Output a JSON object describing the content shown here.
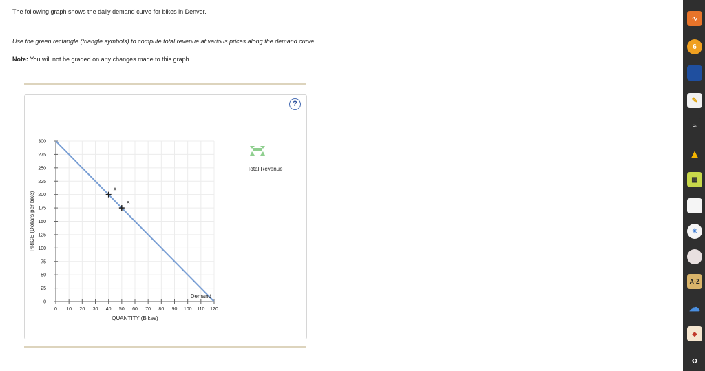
{
  "instructions": {
    "line1": "The following graph shows the daily demand curve for bikes in Denver.",
    "line2": "Use the green rectangle (triangle symbols) to compute total revenue at various prices along the demand curve.",
    "note_label": "Note:",
    "note_text": " You will not be graded on any changes made to this graph."
  },
  "help_button": {
    "label": "?"
  },
  "palette": {
    "label": "Total Revenue",
    "color": "#8fcf8f"
  },
  "chart_data": {
    "type": "line",
    "xlabel": "QUANTITY (Bikes)",
    "ylabel": "PRICE (Dollars per bike)",
    "xlim": [
      0,
      120
    ],
    "ylim": [
      0,
      300
    ],
    "x_ticks": [
      0,
      10,
      20,
      30,
      40,
      50,
      60,
      70,
      80,
      90,
      100,
      110,
      120
    ],
    "y_ticks": [
      0,
      25,
      50,
      75,
      100,
      125,
      150,
      175,
      200,
      225,
      250,
      275,
      300
    ],
    "grid": true,
    "series": [
      {
        "name": "Demand",
        "points": [
          [
            0,
            300
          ],
          [
            120,
            0
          ]
        ],
        "color": "#7a9fd4"
      }
    ],
    "points": [
      {
        "label": "A",
        "x": 40,
        "y": 200
      },
      {
        "label": "B",
        "x": 50,
        "y": 175
      }
    ]
  },
  "toolbar": {
    "icons": [
      "rss-icon",
      "six-icon",
      "book-icon",
      "notepad-icon",
      "sound-icon",
      "drive-icon",
      "cart-icon",
      "document-icon",
      "sun-icon",
      "badge-icon",
      "az-icon",
      "cloud-icon",
      "cy-icon",
      "chevron-icon"
    ],
    "az_label": "A-Z",
    "six_label": "6"
  }
}
